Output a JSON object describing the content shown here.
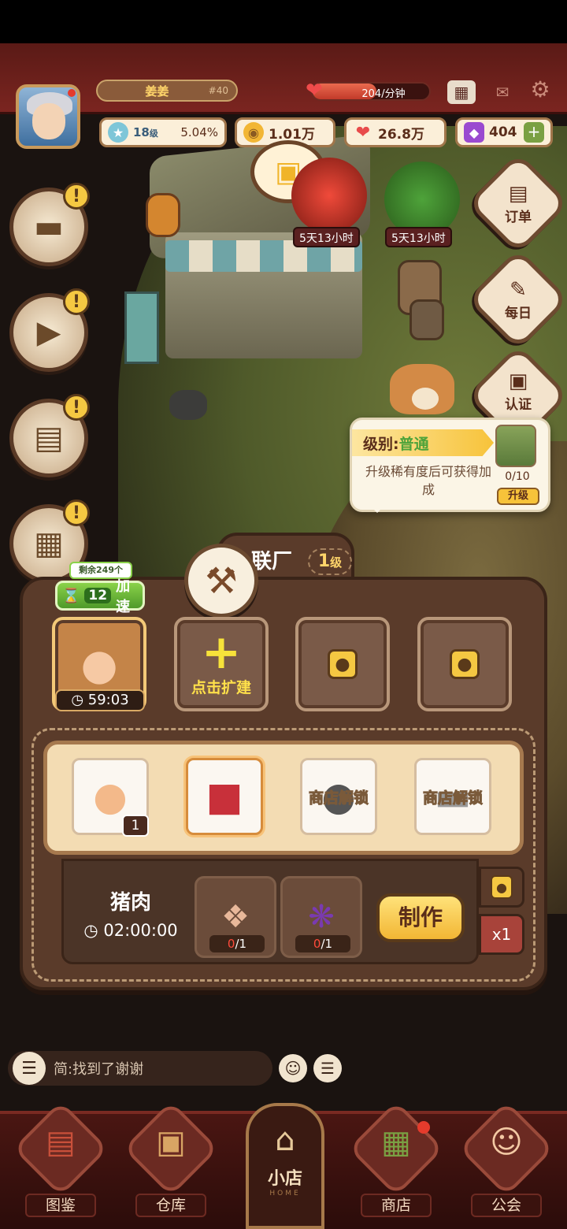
{
  "player": {
    "name": "姜姜",
    "id_tag": "#40",
    "level": "18",
    "level_unit": "级",
    "exp_percent": "5.04%"
  },
  "resources": {
    "hearts_rate": "204/分钟",
    "coins": "1.01万",
    "hearts": "26.8万",
    "gems": "404"
  },
  "events": [
    {
      "label": "5天13小时"
    },
    {
      "label": "5天13小时"
    }
  ],
  "right_menu": [
    {
      "label": "订单",
      "icon": "document-icon"
    },
    {
      "label": "每日",
      "icon": "checklist-icon"
    },
    {
      "label": "认证",
      "icon": "id-card-icon"
    }
  ],
  "tooltip": {
    "level_prefix": "级别:",
    "level_value": "普通",
    "desc": "升级稀有度后可获得加成",
    "progress": "0/10",
    "upgrade": "升级"
  },
  "factory": {
    "title": "联厂",
    "level": "1",
    "level_unit": "级",
    "remaining": "剩余249个",
    "speed_count": "12",
    "speed_label": "加速",
    "timer": "59:03",
    "expand_label": "点击扩建"
  },
  "recipes": [
    {
      "name": "chicken",
      "count": "1"
    },
    {
      "name": "pork"
    },
    {
      "locked_label": "商店解锁"
    },
    {
      "locked_label": "商店解锁"
    }
  ],
  "craft": {
    "item": "猪肉",
    "time": "02:00:00",
    "ingredients": [
      {
        "name": "shrimp",
        "have": "0",
        "need": "/1"
      },
      {
        "name": "grape",
        "have": "0",
        "need": "/1"
      }
    ],
    "button": "制作",
    "multiplier": "x1"
  },
  "chat": {
    "message": "简:找到了谢谢"
  },
  "nav": {
    "items": [
      "图鉴",
      "仓库",
      "商店",
      "公会"
    ],
    "home_label": "小店",
    "home_sub": "HOME"
  }
}
